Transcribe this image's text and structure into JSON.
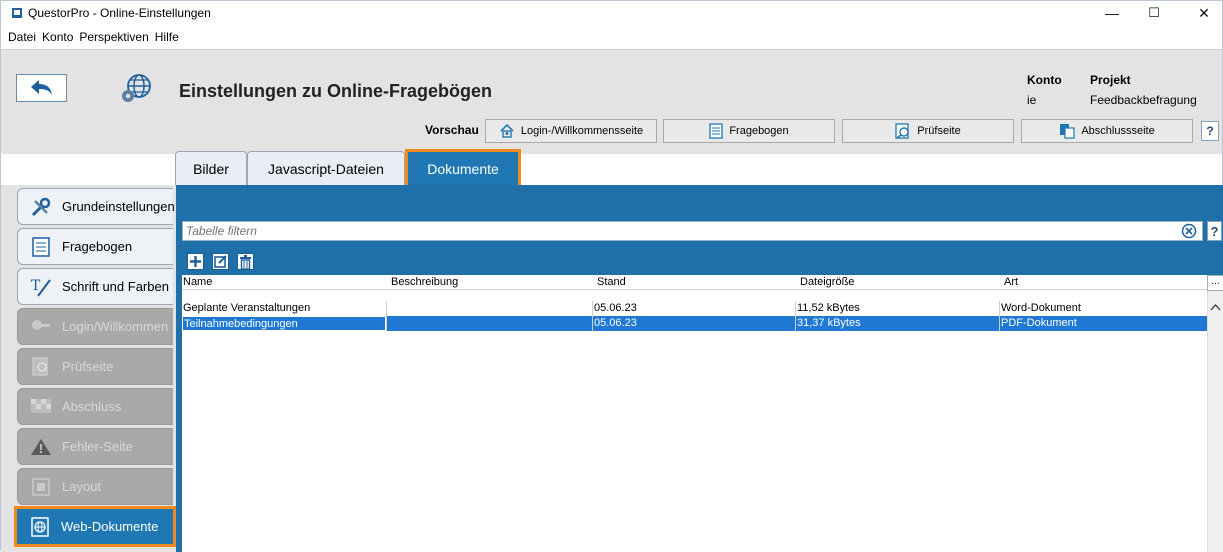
{
  "window": {
    "title": "QuestorPro - Online-Einstellungen",
    "minimize": "—",
    "maximize": "☐",
    "close": "✕"
  },
  "menu": [
    "Datei",
    "Konto",
    "Perspektiven",
    "Hilfe"
  ],
  "header": {
    "title": "Einstellungen zu Online-Fragebögen",
    "konto_label": "Konto",
    "konto_value": "ie",
    "projekt_label": "Projekt",
    "projekt_value": "Feedbackbefragung"
  },
  "preview": {
    "label": "Vorschau",
    "buttons": [
      "Login-/Willkommensseite",
      "Fragebogen",
      "Prüfseite",
      "Abschlussseite"
    ],
    "help": "?"
  },
  "tabs": [
    "Bilder",
    "Javascript-Dateien",
    "Dokumente"
  ],
  "active_tab": "Dokumente",
  "filter": {
    "placeholder": "Tabelle filtern",
    "help": "?"
  },
  "table": {
    "more": "...",
    "columns": [
      "Name",
      "Beschreibung",
      "Stand",
      "Dateigröße",
      "Art"
    ],
    "rows": [
      [
        "Geplante Veranstaltungen",
        "",
        "05.06.23",
        "11,52 kBytes",
        "Word-Dokument"
      ],
      [
        "Teilnahmebedingungen",
        "",
        "05.06.23",
        "31,37 kBytes",
        "PDF-Dokument"
      ]
    ],
    "selected_row": 1
  },
  "sidebar": {
    "items": [
      {
        "label": "Grundeinstellungen",
        "icon": "tools-icon",
        "state": "normal"
      },
      {
        "label": "Fragebogen",
        "icon": "questionnaire-icon",
        "state": "normal"
      },
      {
        "label": "Schrift und Farben",
        "icon": "font-icon",
        "state": "normal"
      },
      {
        "label": "Login/Willkommen",
        "icon": "key-icon",
        "state": "disabled"
      },
      {
        "label": "Prüfseite",
        "icon": "check-page-icon",
        "state": "disabled"
      },
      {
        "label": "Abschluss",
        "icon": "flag-icon",
        "state": "disabled"
      },
      {
        "label": "Fehler-Seite",
        "icon": "warning-icon",
        "state": "disabled"
      },
      {
        "label": "Layout",
        "icon": "layout-icon",
        "state": "disabled"
      },
      {
        "label": "Web-Dokumente",
        "icon": "web-document-icon",
        "state": "active"
      }
    ]
  },
  "colors": {
    "accent": "#1f78b4",
    "highlight": "#f08a1d",
    "selection": "#1f78d4"
  }
}
